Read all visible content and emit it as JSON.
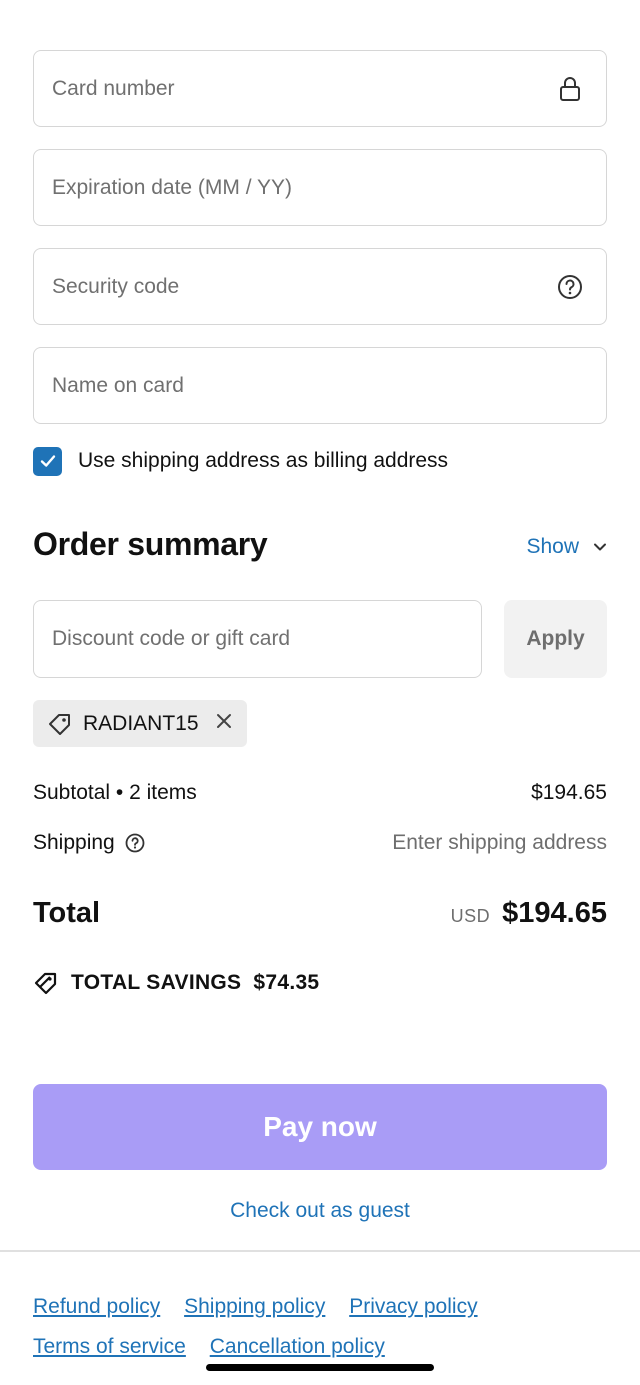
{
  "payment": {
    "card_number_placeholder": "Card number",
    "expiration_placeholder": "Expiration date (MM / YY)",
    "security_code_placeholder": "Security code",
    "name_on_card_placeholder": "Name on card",
    "billing_checkbox_label": "Use shipping address as billing address",
    "billing_checked": true
  },
  "order_summary": {
    "title": "Order summary",
    "toggle_label": "Show",
    "discount_placeholder": "Discount code or gift card",
    "apply_label": "Apply",
    "applied_code": "RADIANT15",
    "subtotal_label": "Subtotal • 2 items",
    "subtotal_value": "$194.65",
    "shipping_label": "Shipping",
    "shipping_value": "Enter shipping address",
    "total_label": "Total",
    "currency": "USD",
    "total_value": "$194.65",
    "savings_label": "TOTAL SAVINGS",
    "savings_value": "$74.35"
  },
  "actions": {
    "pay_label": "Pay now",
    "guest_label": "Check out as guest"
  },
  "footer": {
    "links": [
      "Refund policy",
      "Shipping policy",
      "Privacy policy",
      "Terms of service",
      "Cancellation policy"
    ]
  },
  "colors": {
    "accent": "#1f73b7",
    "pay_button": "#a99cf6"
  }
}
